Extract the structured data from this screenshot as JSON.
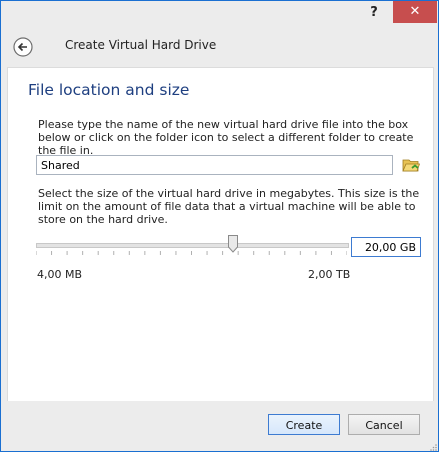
{
  "titlebar": {
    "help_label": "?",
    "close_label": "✕"
  },
  "header": {
    "title": "Create Virtual Hard Drive"
  },
  "section": {
    "title": "File location and size",
    "description_file": "Please type the name of the new virtual hard drive file into the box below or click on the folder icon to select a different folder to create the file in.",
    "file_value": "Shared",
    "description_size": "Select the size of the virtual hard drive in megabytes. This size is the limit on the amount of file data that a virtual machine will be able to store on the hard drive.",
    "size_value": "20,00 GB",
    "slider_min_label": "4,00 MB",
    "slider_max_label": "2,00 TB",
    "slider_level_fraction": 0.635
  },
  "footer": {
    "create_label": "Create",
    "cancel_label": "Cancel"
  },
  "colors": {
    "title_blue": "#1e3f80",
    "close_red": "#c74e4e",
    "accent_blue": "#3d7bd1"
  }
}
